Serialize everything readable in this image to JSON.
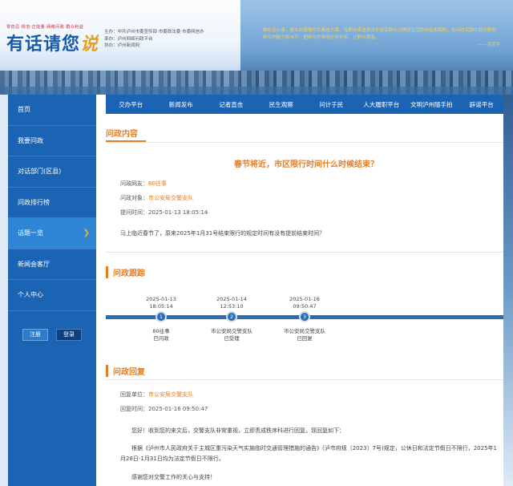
{
  "header": {
    "logo_small": "零容忍·规范·正能量·网络问政·群众利益",
    "logo_title": "有话请您",
    "logo_accent": "说",
    "info_lines": [
      "主办：中共泸州市委宣传部  市委政法委  市委网信办",
      "承办：泸州网络问政平台",
      "协办：泸州新闻网"
    ],
    "slogan": "群众无小事，群众的事情件件都是大事。在群众来信来访中感受群众对美好生活的向往和期盼，在问政实践中提升服务群众的能力和水平，把群众的事情办好办实，让群众满意。",
    "slogan_author": "——习近平"
  },
  "sidebar": {
    "items": [
      {
        "label": "首页"
      },
      {
        "label": "我要问政"
      },
      {
        "label": "对话部门(区县)"
      },
      {
        "label": "问政排行榜"
      },
      {
        "label": "话题一览"
      },
      {
        "label": "新闻会客厅"
      },
      {
        "label": "个人中心"
      }
    ],
    "register": "注册",
    "login": "登录"
  },
  "topnav": [
    "交办平台",
    "新闻发布",
    "记者直击",
    "民生观察",
    "问计于民",
    "人大履职平台",
    "文明泸州随手拍",
    "辟谣平台"
  ],
  "content": {
    "section_title": "问政内容",
    "question_title": "春节将近，市区限行时间什么时候结束？",
    "asker_label": "问政网友：",
    "asker": "80往事",
    "target_label": "问政对象：",
    "target": "市公安局交警支队",
    "time_label": "提问时间：",
    "time": "2025-01-13 18:05:14",
    "question_body": "马上临近春节了，原来2025年1月31号结束限行的规定时间有没有提前结束时间？"
  },
  "tracking": {
    "section_title": "问政跟踪",
    "steps": [
      {
        "num": "1",
        "date": "2025-01-13",
        "time": "18:05:14",
        "who": "80往事",
        "status": "已问政"
      },
      {
        "num": "2",
        "date": "2025-01-14",
        "time": "12:53:10",
        "who": "市公安局交警支队",
        "status": "已受理"
      },
      {
        "num": "3",
        "date": "2025-01-16",
        "time": "09:50:47",
        "who": "市公安局交警支队",
        "status": "已回复"
      }
    ]
  },
  "reply": {
    "section_title": "问政回复",
    "unit_label": "回复单位：",
    "unit": "市公安局交警支队",
    "time_label": "回复时间：",
    "time": "2025-01-16 09:50:47",
    "p1": "您好！收到您的来文后，交警支队非常重视，立即责成秩序科进行回复。现回复如下：",
    "p2": "根据《泸州市人民政府关于主城区重污染天气实施临时交通管理措施的通告》(泸市府规〔2023〕7号)规定，公休日和法定节假日不限行，2025年1月28日-1月31日均为法定节假日不限行。",
    "p3": "感谢您对交警工作的关心与支持！"
  },
  "colors": {
    "brand_blue": "#1b64b3",
    "accent_orange": "#e67e22",
    "chevron_yellow": "#f2b21e"
  }
}
